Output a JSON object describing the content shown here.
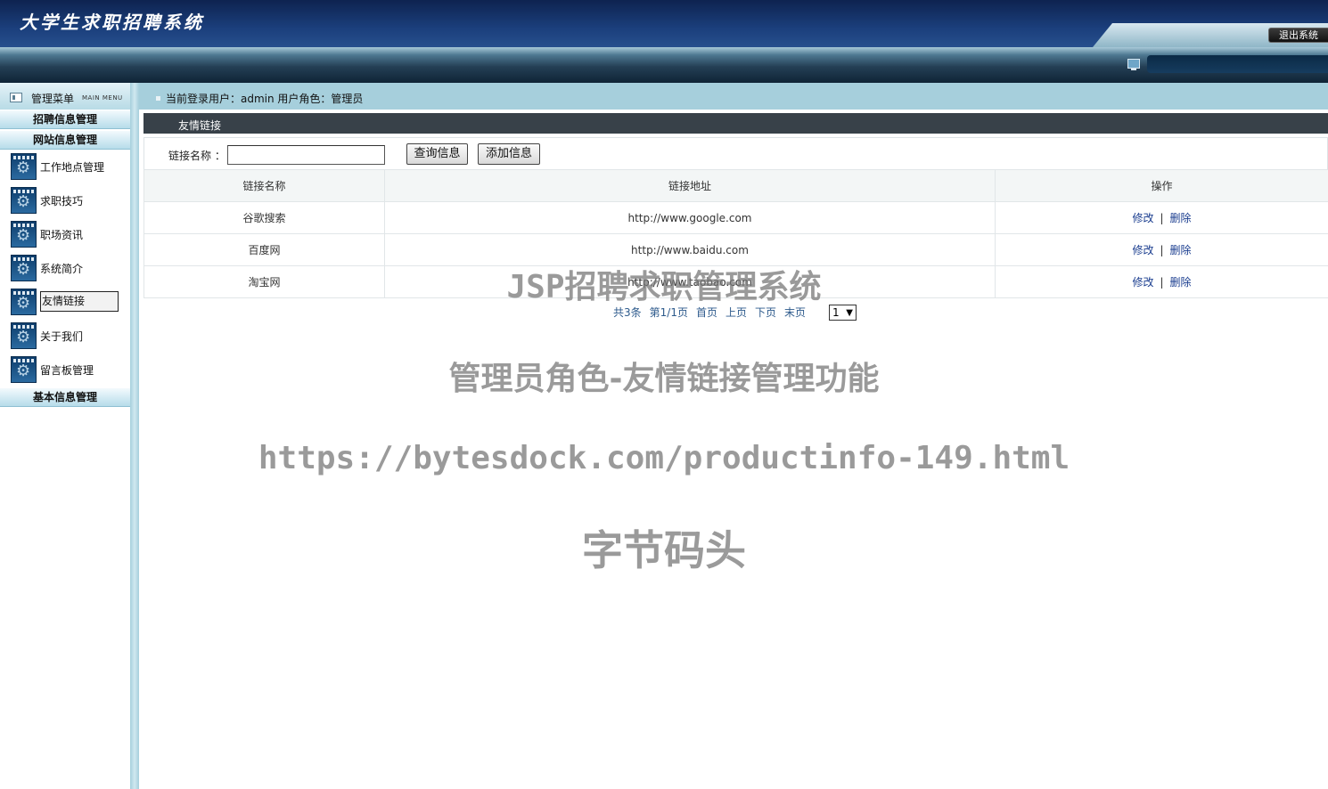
{
  "header": {
    "app_title": "大学生求职招聘系统",
    "logout_label": "退出系统"
  },
  "sidebar": {
    "title": "管理菜单",
    "subtitle": "MAIN MENU",
    "groups": [
      {
        "label": "招聘信息管理"
      },
      {
        "label": "网站信息管理"
      },
      {
        "label": "基本信息管理"
      }
    ],
    "items": [
      {
        "label": "工作地点管理"
      },
      {
        "label": "求职技巧"
      },
      {
        "label": "职场资讯"
      },
      {
        "label": "系统简介"
      },
      {
        "label": "友情链接",
        "active": true
      },
      {
        "label": "关于我们"
      },
      {
        "label": "留言板管理"
      }
    ]
  },
  "topline": {
    "current_user": "当前登录用户：admin  用户角色：管理员"
  },
  "panel": {
    "title": "友情链接",
    "search_label": "链接名称 ：",
    "search_value": "",
    "query_button": "查询信息",
    "add_button": "添加信息"
  },
  "table": {
    "headers": [
      "链接名称",
      "链接地址",
      "操作"
    ],
    "rows": [
      {
        "name": "谷歌搜索",
        "url": "http://www.google.com",
        "edit": "修改",
        "sep": "|",
        "delete": "删除"
      },
      {
        "name": "百度网",
        "url": "http://www.baidu.com",
        "edit": "修改",
        "sep": "|",
        "delete": "删除"
      },
      {
        "name": "淘宝网",
        "url": "http://www.taobao.com",
        "edit": "修改",
        "sep": "|",
        "delete": "删除"
      }
    ]
  },
  "pager": {
    "total": "共3条",
    "page": "第1/1页",
    "first": "首页",
    "prev": "上页",
    "next": "下页",
    "last": "末页",
    "selected": "1"
  },
  "watermark": {
    "line1": "JSP招聘求职管理系统",
    "line2": "管理员角色-友情链接管理功能",
    "line3": "https://bytesdock.com/productinfo-149.html",
    "line4": "字节码头"
  }
}
